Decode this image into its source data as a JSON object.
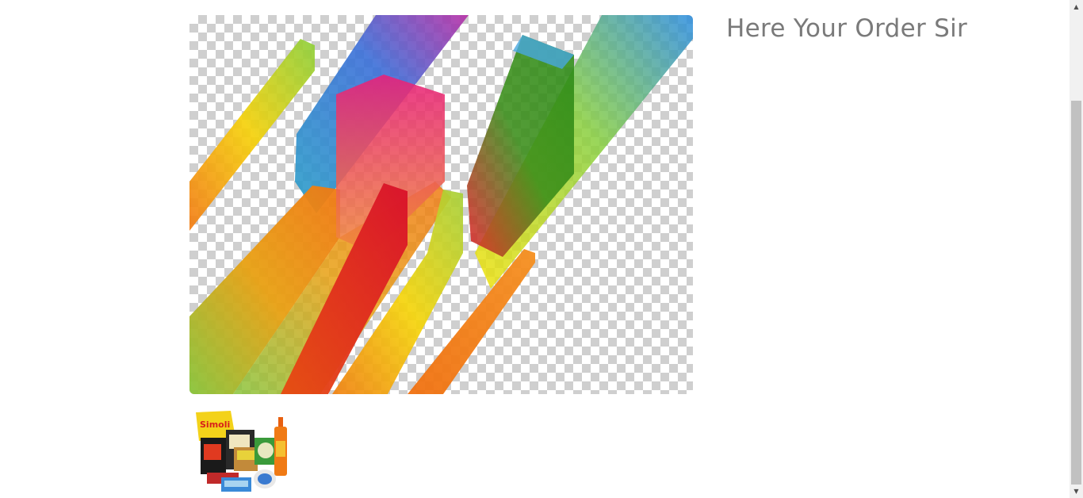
{
  "order": {
    "title": "Here Your Order Sir"
  },
  "images": {
    "main": "abstract-colorful-stripes-image",
    "thumbnail": "grocery-products-thumbnail",
    "thumbnail_brand_text": "Simoli"
  },
  "scrollbar": {
    "up_icon": "triangle-up-icon",
    "down_icon": "triangle-down-icon"
  },
  "colors": {
    "title_text": "#7a7a7a",
    "checker": "#cfcfcf",
    "scroll_track": "#f1f1f1",
    "scroll_thumb": "#c1c1c1"
  }
}
